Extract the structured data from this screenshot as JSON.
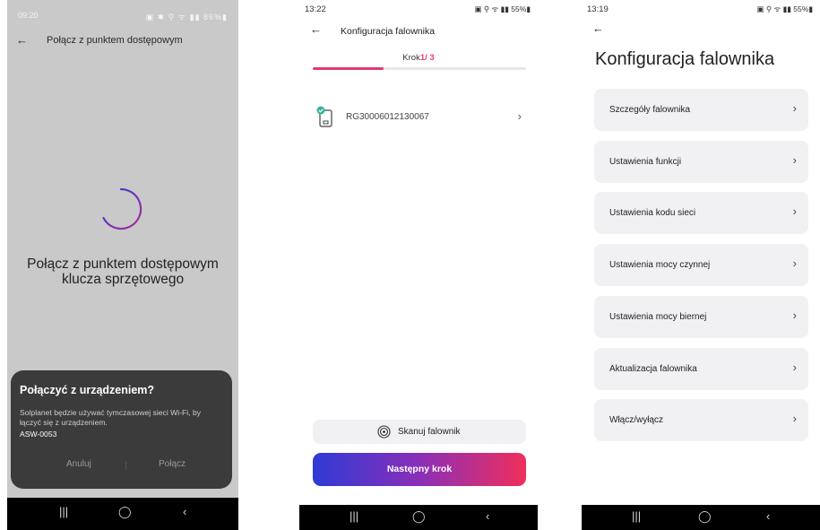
{
  "screen1": {
    "status_time": "09:20",
    "status_icons": "▣ ✱ ⚲ ᯤ ▮▮ 86%▮",
    "back_icon": "arrow-left",
    "header_title": "Połącz z punktem dostępowym",
    "message_line1": "Połącz z punktem dostępowym",
    "message_line2": "klucza sprzętowego",
    "dialog": {
      "title": "Połączyć z urządzeniem?",
      "text": "Solplanet będzie używać tymczasowej sieci Wi-Fi, by łączyć się z urządzeniem.",
      "device": "ASW-0053",
      "cancel": "Anuluj",
      "connect": "Połącz"
    },
    "nav": [
      "|||",
      "◯",
      "‹"
    ]
  },
  "screen2": {
    "status_time": "13:22",
    "status_icons": "▣ ⚲ ᯤ ▮▮ 55%▮",
    "header_title": "Konfiguracja falownika",
    "step_label": "Krok",
    "step_current": "1",
    "step_total": "/ 3",
    "progress": 0.33,
    "device_serial": "RG30006012130067",
    "scan_label": "Skanuj falownik",
    "next_label": "Następny krok",
    "accent_color": "#ec3a6a",
    "nav": [
      "|||",
      "◯",
      "‹"
    ]
  },
  "screen3": {
    "status_time": "13:19",
    "status_icons": "▣ ⚲ ᯤ ▮▮ 55%▮",
    "page_title": "Konfiguracja falownika",
    "menu": [
      {
        "label": "Szczegóły falownika"
      },
      {
        "label": "Ustawienia funkcji"
      },
      {
        "label": "Ustawienia kodu sieci"
      },
      {
        "label": "Ustawienia mocy czynnej"
      },
      {
        "label": "Ustawienia mocy biernej"
      },
      {
        "label": "Aktualizacja falownika"
      },
      {
        "label": "Włącz/wyłącz"
      }
    ],
    "nav": [
      "|||",
      "◯",
      "‹"
    ]
  }
}
